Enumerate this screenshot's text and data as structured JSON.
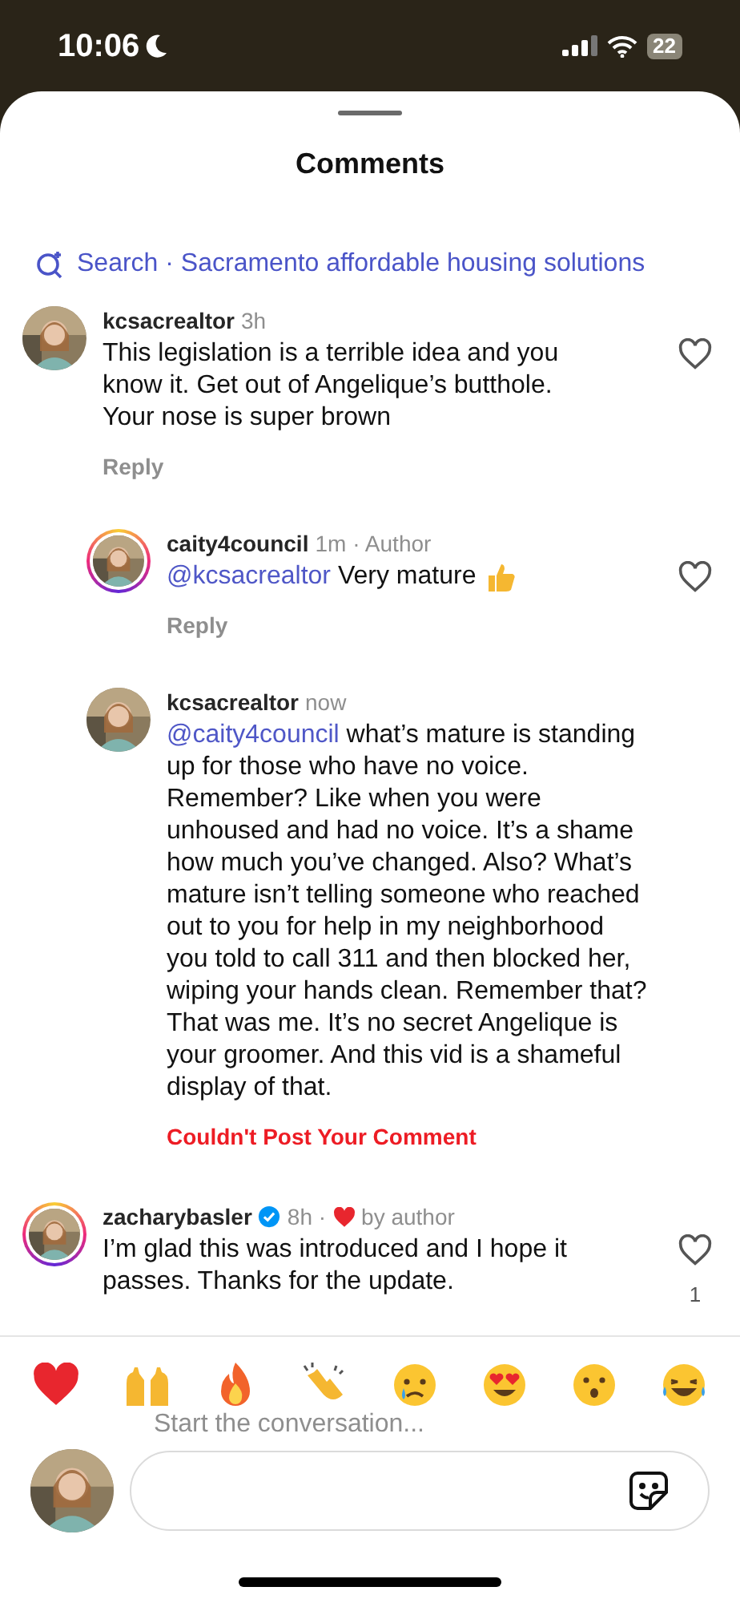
{
  "status_bar": {
    "time": "10:06",
    "battery": "22"
  },
  "sheet": {
    "title": "Comments"
  },
  "search": {
    "label": "Search · Sacramento affordable housing solutions"
  },
  "comments": [
    {
      "username": "kcsacrealtor",
      "time": "3h",
      "story_ring": false,
      "text": "This legislation is a terrible idea and you know it. Get out of  Angelique’s butthole. Your nose is super brown",
      "reply": "Reply",
      "replies": [
        {
          "username": "caity4council",
          "time": "1m",
          "badge": "· Author",
          "story_ring": true,
          "mention": "@kcsacrealtor",
          "text": "Very mature",
          "thumbs_up": true,
          "reply": "Reply"
        },
        {
          "username": "kcsacrealtor",
          "time": "now",
          "story_ring": false,
          "mention": "@caity4council",
          "text": "what’s mature is standing up for those who have no voice. Remember? Like when you were unhoused and had no voice. It’s a shame how much you’ve changed. Also? What’s mature isn’t telling someone who reached out to you for help in my neighborhood you told to call 311 and then blocked her, wiping your hands clean. Remember that? That was me. It’s no secret Angelique is your groomer. And this vid is a shameful display of that.",
          "error": "Couldn't Post Your Comment"
        }
      ]
    },
    {
      "username": "zacharybasler",
      "verified": true,
      "time": "8h ·",
      "story_ring": true,
      "liked_by_author": "by author",
      "text": "I’m glad this was introduced and I hope it passes. Thanks for the update.",
      "likes": "1"
    }
  ],
  "reactions": [
    {
      "kind": "heart"
    },
    {
      "kind": "raised-hands"
    },
    {
      "kind": "fire"
    },
    {
      "kind": "clap"
    },
    {
      "kind": "crying"
    },
    {
      "kind": "heart-eyes"
    },
    {
      "kind": "surprised"
    },
    {
      "kind": "laughing"
    }
  ],
  "composer": {
    "prompt": "Start the conversation..."
  }
}
